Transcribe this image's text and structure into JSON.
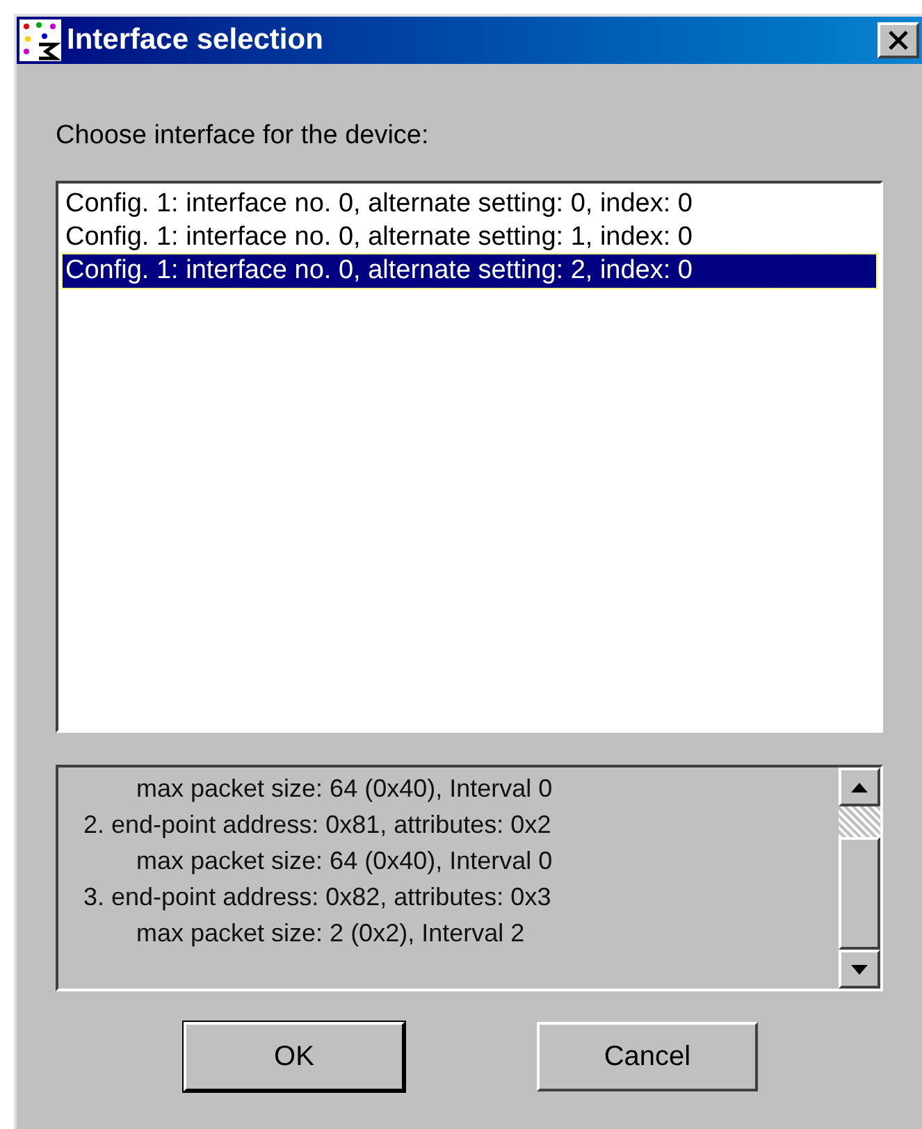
{
  "window": {
    "title": "Interface selection"
  },
  "prompt": "Choose interface for the device:",
  "interfaces": [
    {
      "label": "Config. 1: interface no. 0, alternate setting: 0, index: 0",
      "selected": false
    },
    {
      "label": "Config. 1: interface no. 0, alternate setting: 1, index: 0",
      "selected": false
    },
    {
      "label": "Config. 1: interface no. 0, alternate setting: 2, index: 0",
      "selected": true
    }
  ],
  "details": [
    {
      "kind": "sub",
      "text": "max packet size: 64 (0x40),  Interval 0"
    },
    {
      "kind": "endpoint",
      "text": "2. end-point address: 0x81,  attributes: 0x2"
    },
    {
      "kind": "sub",
      "text": "max packet size: 64 (0x40),  Interval 0"
    },
    {
      "kind": "endpoint",
      "text": "3. end-point address: 0x82,  attributes: 0x3"
    },
    {
      "kind": "sub",
      "text": "max packet size: 2 (0x2),  Interval 2"
    }
  ],
  "buttons": [
    {
      "label": "OK",
      "default": true
    },
    {
      "label": "Cancel",
      "default": false
    }
  ]
}
